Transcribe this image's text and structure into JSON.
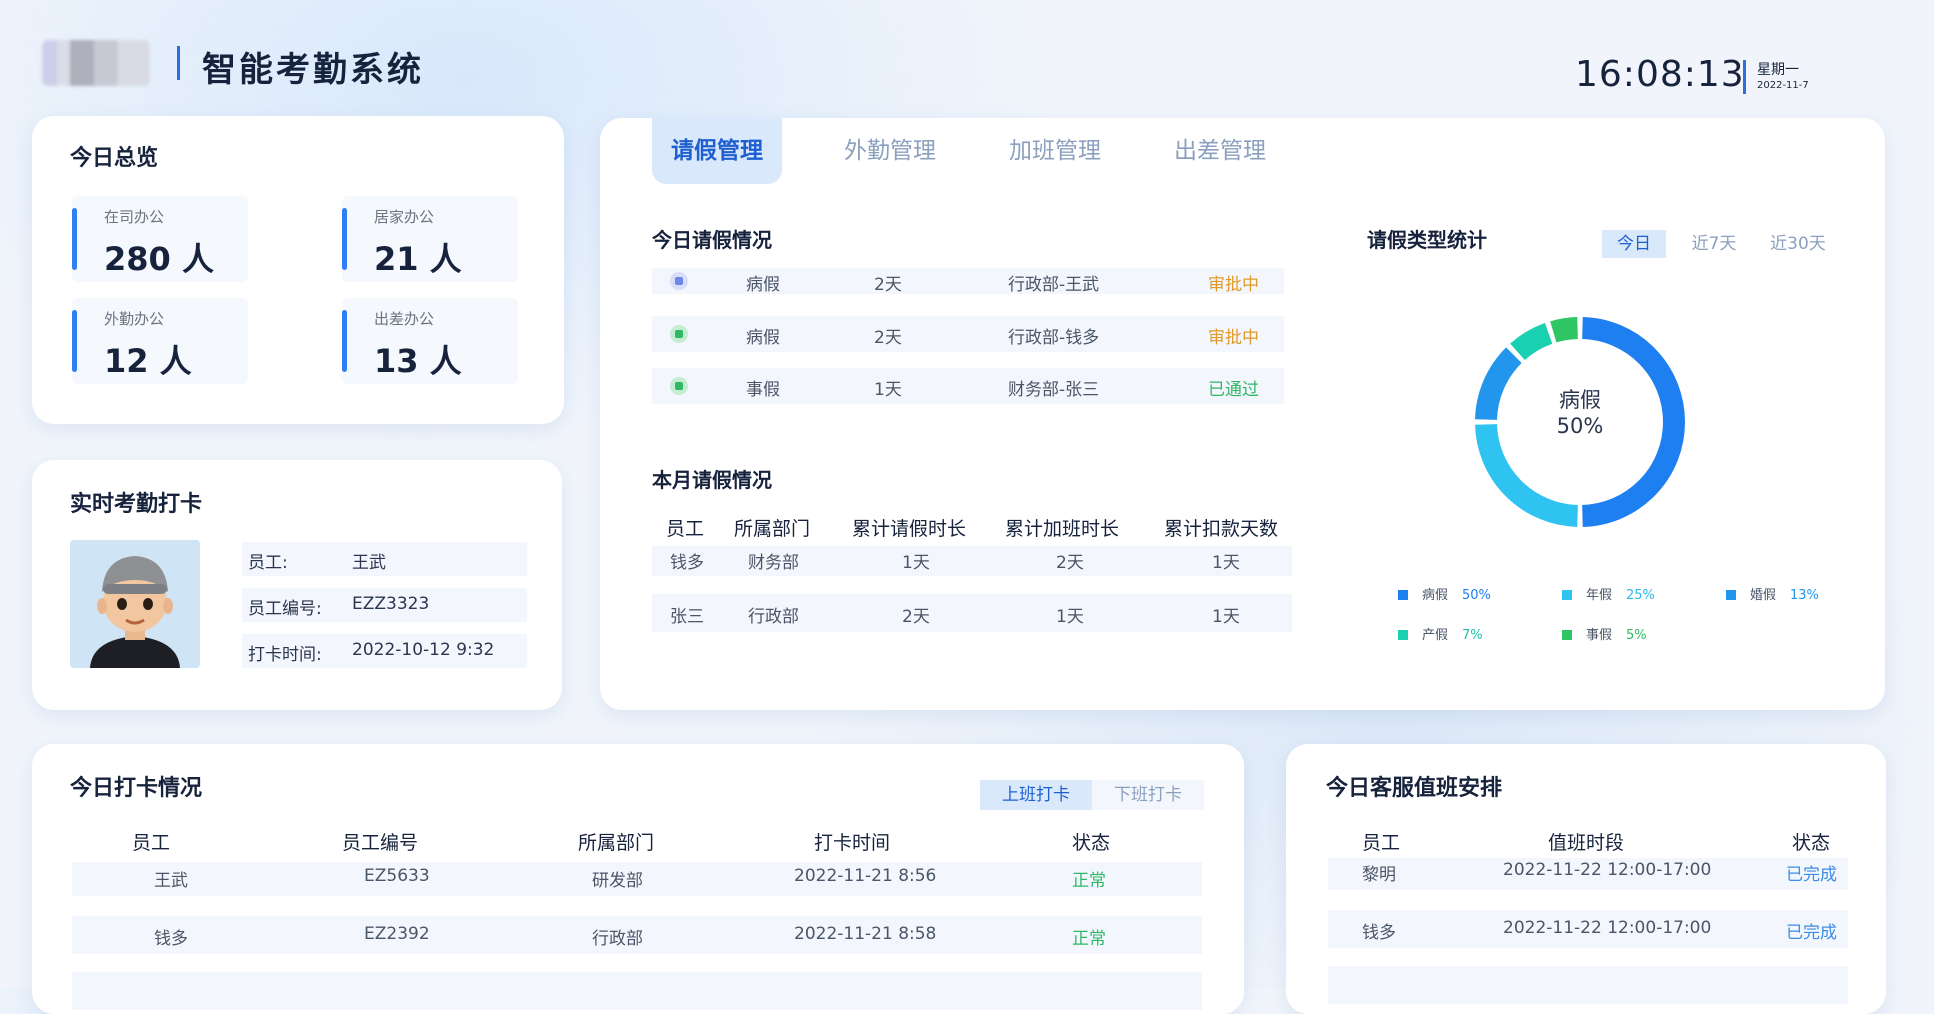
{
  "header": {
    "title": "智能考勤系统",
    "time": "16:08:13",
    "weekday": "星期一",
    "date": "2022-11-7"
  },
  "overview": {
    "title": "今日总览",
    "stats": [
      {
        "label": "在司办公",
        "value": "280 人"
      },
      {
        "label": "居家办公",
        "value": "21 人"
      },
      {
        "label": "外勤办公",
        "value": "12 人"
      },
      {
        "label": "出差办公",
        "value": "13 人"
      }
    ]
  },
  "checkin": {
    "title": "实时考勤打卡",
    "rows": [
      {
        "key": "员工:",
        "value": "王武"
      },
      {
        "key": "员工编号:",
        "value": "EZZ3323"
      },
      {
        "key": "打卡时间:",
        "value": "2022-10-12 9:32"
      }
    ]
  },
  "tabs": [
    {
      "label": "请假管理",
      "active": true
    },
    {
      "label": "外勤管理",
      "active": false
    },
    {
      "label": "加班管理",
      "active": false
    },
    {
      "label": "出差管理",
      "active": false
    }
  ],
  "today_leave": {
    "title": "今日请假情况",
    "rows": [
      {
        "type": "病假",
        "days": "2天",
        "person": "行政部-王武",
        "status": "审批中"
      },
      {
        "type": "病假",
        "days": "2天",
        "person": "行政部-钱多",
        "status": "审批中"
      },
      {
        "type": "事假",
        "days": "1天",
        "person": "财务部-张三",
        "status": "已通过"
      }
    ]
  },
  "month_leave": {
    "title": "本月请假情况",
    "headers": [
      "员工",
      "所属部门",
      "累计请假时长",
      "累计加班时长",
      "累计扣款天数"
    ],
    "rows": [
      [
        "钱多",
        "财务部",
        "1天",
        "2天",
        "1天"
      ],
      [
        "张三",
        "行政部",
        "2天",
        "1天",
        "1天"
      ]
    ]
  },
  "leave_stats": {
    "title": "请假类型统计",
    "ranges": [
      {
        "label": "今日",
        "active": true
      },
      {
        "label": "近7天",
        "active": false
      },
      {
        "label": "近30天",
        "active": false
      }
    ],
    "center_label": "病假",
    "center_value": "50%"
  },
  "chart_data": {
    "type": "pie",
    "categories": [
      "病假",
      "年假",
      "婚假",
      "产假",
      "事假"
    ],
    "values": [
      50,
      25,
      13,
      7,
      5
    ],
    "colors": [
      "#1d7ff0",
      "#2fc3f2",
      "#2196ec",
      "#19d1b0",
      "#2fc464"
    ],
    "legend_labels": [
      "50%",
      "25%",
      "13%",
      "7%",
      "5%"
    ]
  },
  "punch": {
    "title": "今日打卡情况",
    "toggle": [
      {
        "label": "上班打卡",
        "active": true
      },
      {
        "label": "下班打卡",
        "active": false
      }
    ],
    "headers": [
      "员工",
      "员工编号",
      "所属部门",
      "打卡时间",
      "状态"
    ],
    "rows": [
      [
        "王武",
        "EZ5633",
        "研发部",
        "2022-11-21 8:56",
        "正常"
      ],
      [
        "钱多",
        "EZ2392",
        "行政部",
        "2022-11-21 8:58",
        "正常"
      ]
    ]
  },
  "duty": {
    "title": "今日客服值班安排",
    "headers": [
      "员工",
      "值班时段",
      "状态"
    ],
    "rows": [
      [
        "黎明",
        "2022-11-22 12:00-17:00",
        "已完成"
      ],
      [
        "钱多",
        "2022-11-22 12:00-17:00",
        "已完成"
      ]
    ]
  }
}
